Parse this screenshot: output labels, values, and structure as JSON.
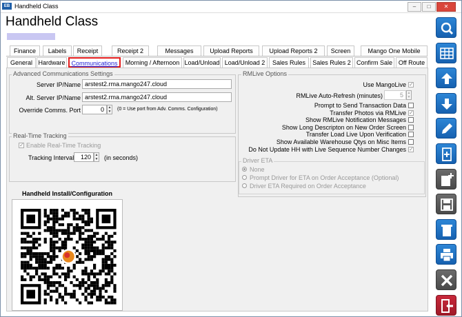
{
  "window": {
    "title": "Handheld Class",
    "minimize": "–",
    "maximize": "□",
    "close": "✕",
    "app_icon": "app-logo-icon"
  },
  "page": {
    "title": "Handheld Class"
  },
  "tabs_row1": [
    "Finance",
    "Labels",
    "Receipt",
    "Receipt 2",
    "Messages",
    "Upload Reports",
    "Upload Reports 2",
    "Screen",
    "Mango One Mobile"
  ],
  "tabs_row2": [
    "General",
    "Hardware",
    "Communications",
    "Morning / Afternoon",
    "Load/Unload",
    "Load/Unload 2",
    "Sales Rules",
    "Sales Rules 2",
    "Confirm Sale",
    "Off Route"
  ],
  "active_tab": "Communications",
  "adv_comms": {
    "legend": "Advanced Communications Settings",
    "server_label": "Server IP/Name",
    "server_value": "arstest2.rma.mango247.cloud",
    "alt_server_label": "Alt. Server IP/Name",
    "alt_server_value": "arstest2.rma.mango247.cloud",
    "port_label": "Override Comms. Port",
    "port_value": "0",
    "port_note": "(0 = Use port from Adv. Comms. Configuration)"
  },
  "realtime": {
    "legend": "Real-Time Tracking",
    "enable_label": "Enable Real-Time Tracking",
    "interval_label": "Tracking Interval",
    "interval_value": "120",
    "interval_unit": "(in seconds)"
  },
  "install": {
    "title": "Handheld Install/Configuration"
  },
  "rmlive": {
    "legend": "RMLive Options",
    "use_label": "Use MangoLive",
    "refresh_label": "RMLive Auto-Refresh (minutes)",
    "refresh_value": "5",
    "options": [
      {
        "label": "Prompt to Send Transaction Data",
        "checked": false
      },
      {
        "label": "Transfer Photos via RMLive",
        "checked": true
      },
      {
        "label": "Show RMLive Notification Messages",
        "checked": false
      },
      {
        "label": "Show Long Descripton on New Order Screen",
        "checked": false
      },
      {
        "label": "Transfer Load Live Upon Verification",
        "checked": false
      },
      {
        "label": "Show Available Warehouse Qtys on Misc Items",
        "checked": false
      },
      {
        "label": "Do Not Update HH with Live Sequence Number Changes",
        "checked": true
      }
    ]
  },
  "driver_eta": {
    "legend": "Driver ETA",
    "options": [
      "None",
      "Prompt Driver for ETA on Order Acceptance (Optional)",
      "Driver ETA Required on Order Acceptance"
    ],
    "selected": "None"
  },
  "sidebar_icons": [
    "search-icon",
    "grid-icon",
    "arrow-up-icon",
    "arrow-down-icon",
    "edit-icon",
    "new-document-icon",
    "add-document-icon",
    "save-icon",
    "delete-icon",
    "print-icon",
    "cancel-icon",
    "exit-icon"
  ],
  "colors": {
    "accent_blue": "#1e74c6",
    "active_tab_border": "#e21b1b",
    "exit_red": "#b3202f",
    "disabled_gray": "#5a5a5a"
  }
}
